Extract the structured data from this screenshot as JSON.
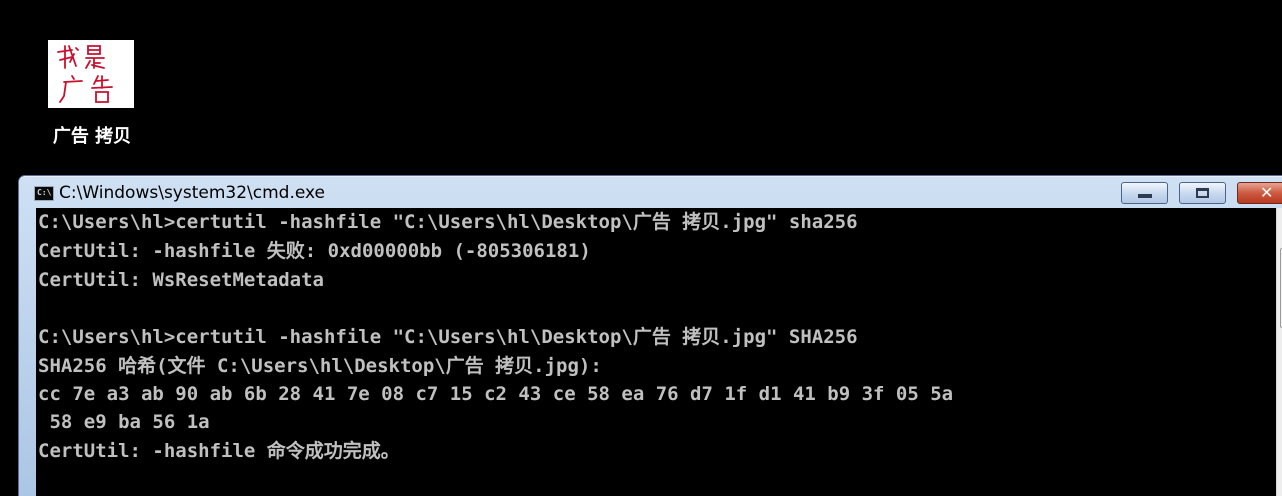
{
  "desktop": {
    "icon_name": "image-file-icon",
    "thumbnail_text": "我是广告",
    "label": "广告 拷贝"
  },
  "window": {
    "title": "C:\\Windows\\system32\\cmd.exe",
    "app_icon_text": "C:\\",
    "buttons": {
      "minimize": "minimize-icon",
      "maximize": "maximize-icon",
      "close": "close-icon"
    }
  },
  "console": {
    "lines": [
      "C:\\Users\\hl>certutil -hashfile \"C:\\Users\\hl\\Desktop\\广告 拷贝.jpg\" sha256",
      "CertUtil: -hashfile 失败: 0xd00000bb (-805306181)",
      "CertUtil: WsResetMetadata",
      "",
      "C:\\Users\\hl>certutil -hashfile \"C:\\Users\\hl\\Desktop\\广告 拷贝.jpg\" SHA256",
      "SHA256 哈希(文件 C:\\Users\\hl\\Desktop\\广告 拷贝.jpg):",
      "cc 7e a3 ab 90 ab 6b 28 41 7e 08 c7 15 c2 43 ce 58 ea 76 d7 1f d1 41 b9 3f 05 5a",
      " 58 e9 ba 56 1a",
      "CertUtil: -hashfile 命令成功完成。"
    ]
  },
  "colors": {
    "console_text": "#c0c0c0",
    "console_bg": "#000000",
    "thumbnail_ink": "#c8102e"
  }
}
